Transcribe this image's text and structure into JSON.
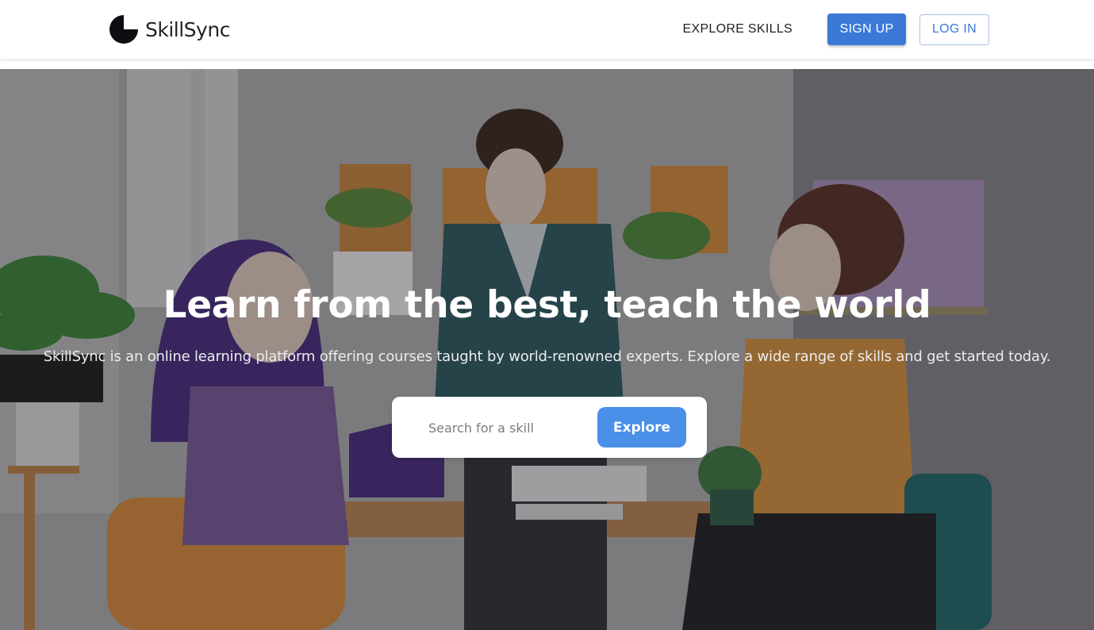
{
  "brand": {
    "name": "SkillSync",
    "logo_icon": "half-circle-logo-icon"
  },
  "nav": {
    "explore_skills": "EXPLORE SKILLS",
    "sign_up": "SIGN UP",
    "log_in": "LOG IN"
  },
  "hero": {
    "title": "Learn from the best, teach the world",
    "subtitle": "SkillSync is an online learning platform offering courses taught by world-renowned experts. Explore a wide range of skills and get started today.",
    "background_image": "illustration-people-studying-office"
  },
  "search": {
    "placeholder": "Search for a skill",
    "value": "",
    "button_label": "Explore"
  },
  "colors": {
    "primary": "#3b79d6",
    "explore_button": "#4a8fe8",
    "header_bg": "#ffffff",
    "brand_text": "#1f2328"
  }
}
